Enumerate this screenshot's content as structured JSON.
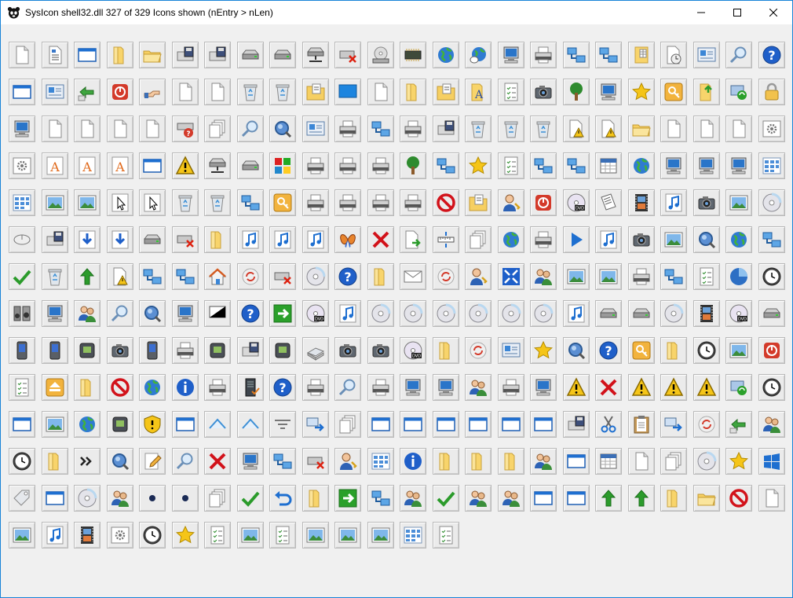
{
  "window": {
    "title": "SysIcon shell32.dll   327 of 329 Icons shown (nEntry > nLen)",
    "controls": {
      "minimize": "minimize-icon",
      "maximize": "maximize-icon",
      "close": "close-icon"
    }
  },
  "grid": {
    "columns": 24,
    "count": 327,
    "icons": [
      "document",
      "wordpad-doc",
      "window",
      "folder",
      "folder-open",
      "floppy-drive",
      "floppy-drive",
      "hard-drive",
      "hard-drive",
      "network-drive",
      "drive-removed",
      "cd-drive",
      "ram-chip",
      "globe",
      "network-globe",
      "computer",
      "printer",
      "network",
      "network",
      "grid-folder",
      "clock-doc",
      "control-panel",
      "search",
      "help",
      "window",
      "control-panel",
      "shortcut",
      "power",
      "hand",
      "blank",
      "blank",
      "recycle-bin",
      "recycle-bin",
      "folder-doc",
      "desktop",
      "folder-printer",
      "folder",
      "folder-doc",
      "font-folder",
      "checklist",
      "camera",
      "tree",
      "computer",
      "star",
      "key",
      "folder-upload",
      "sync",
      "lock",
      "computer",
      "blank",
      "blank",
      "blank",
      "blank",
      "drive-help",
      "documents",
      "search",
      "magnifier",
      "control-panel",
      "printer",
      "network",
      "printer",
      "floppy-drive",
      "recycle-bin",
      "recycle-bin",
      "recycle-bin",
      "warning-doc",
      "warning-doc",
      "folder-open",
      "document",
      "document",
      "document",
      "settings",
      "settings",
      "font",
      "font",
      "font",
      "window",
      "warning",
      "network-drive",
      "hard-drive",
      "programs",
      "printer",
      "printer",
      "printer",
      "tree",
      "network",
      "star",
      "checklist",
      "network",
      "network",
      "calendar",
      "globe",
      "computer",
      "computer",
      "computer",
      "grid",
      "grid",
      "picture",
      "picture",
      "pointer",
      "pointer",
      "recycle-bin",
      "recycle-bin",
      "network",
      "key",
      "printer",
      "printer",
      "printer",
      "printer",
      "block",
      "folder-doc",
      "user",
      "power",
      "dvd",
      "paper",
      "film",
      "music",
      "camera",
      "picture",
      "cd",
      "mouse",
      "floppy-drive",
      "download",
      "download",
      "hard-drive",
      "drive-removed",
      "folder",
      "music",
      "music",
      "music",
      "butterfly",
      "error",
      "document-arrow",
      "ruler",
      "documents",
      "globe",
      "printer",
      "play",
      "music",
      "camera",
      "picture",
      "magnifier",
      "globe",
      "network",
      "check",
      "recycle-bin",
      "arrow-up",
      "warning-doc",
      "network",
      "network",
      "home",
      "recycle",
      "drive-removed",
      "cd",
      "help",
      "folder",
      "mail",
      "recycle",
      "user",
      "expand",
      "users",
      "picture",
      "picture",
      "printer",
      "network",
      "checklist",
      "pie",
      "clock",
      "speakers",
      "computer",
      "users",
      "search",
      "magnifier",
      "computer",
      "monitor",
      "help",
      "go",
      "dvd",
      "music",
      "cd",
      "cd",
      "cd",
      "cd",
      "cd",
      "cd",
      "music",
      "hard-drive",
      "hard-drive",
      "cd",
      "film",
      "dvd",
      "hard-drive",
      "phone",
      "phone",
      "device",
      "camera",
      "phone",
      "printer",
      "device",
      "floppy-drive",
      "device",
      "scanner",
      "camera",
      "camera",
      "dvd",
      "folder",
      "recycle",
      "control-panel",
      "star",
      "magnifier",
      "help",
      "key",
      "folder",
      "clock",
      "picture",
      "power",
      "checklist",
      "eject",
      "folder",
      "block",
      "globe",
      "info",
      "printer",
      "server",
      "help",
      "printer",
      "search",
      "printer",
      "computer",
      "computer",
      "users",
      "printer",
      "computer",
      "warning",
      "error",
      "warning",
      "warning",
      "warning",
      "sync",
      "clock",
      "window",
      "picture",
      "globe",
      "device",
      "shield",
      "window",
      "triangle",
      "triangle",
      "filter",
      "arrow",
      "documents",
      "window",
      "window",
      "window",
      "window",
      "window",
      "window",
      "floppy-drive",
      "scissors",
      "clipboard",
      "arrow",
      "recycle",
      "shortcut",
      "users",
      "clock",
      "folder",
      "chevrons",
      "magnifier",
      "pencil",
      "search",
      "error",
      "computer",
      "network",
      "drive-removed",
      "user",
      "grid",
      "info",
      "folder",
      "folder",
      "folder",
      "users",
      "window",
      "calendar",
      "document",
      "documents",
      "cd",
      "star",
      "windows",
      "tag",
      "window",
      "cd",
      "users",
      "dot",
      "dot",
      "documents",
      "check",
      "undo",
      "folder",
      "go",
      "network",
      "users",
      "check",
      "users",
      "users",
      "window",
      "window",
      "arrow-up",
      "arrow-up",
      "folder",
      "folder-open",
      "block",
      "document",
      "picture",
      "music",
      "film",
      "settings",
      "clock",
      "star",
      "checklist",
      "picture",
      "checklist",
      "picture",
      "picture",
      "picture",
      "grid",
      "checklist"
    ]
  }
}
